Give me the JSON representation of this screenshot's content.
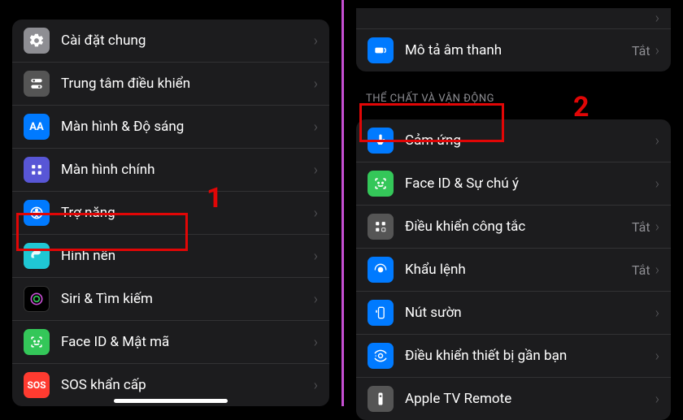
{
  "left": {
    "group1": [
      {
        "label": "Cài đặt chung",
        "key": "general"
      },
      {
        "label": "Trung tâm điều khiển",
        "key": "control-center"
      },
      {
        "label": "Màn hình & Độ sáng",
        "key": "display-brightness"
      },
      {
        "label": "Màn hình chính",
        "key": "home-screen"
      },
      {
        "label": "Trợ năng",
        "key": "accessibility"
      },
      {
        "label": "Hình nền",
        "key": "wallpaper"
      },
      {
        "label": "Siri & Tìm kiếm",
        "key": "siri-search"
      },
      {
        "label": "Face ID & Mật mã",
        "key": "faceid-passcode"
      },
      {
        "label": "SOS khẩn cấp",
        "key": "sos"
      }
    ]
  },
  "right": {
    "top": [
      {
        "label": "Mô tả âm thanh",
        "key": "audio-descriptions",
        "value": "Tắt"
      }
    ],
    "section_header": "THỂ CHẤT VÀ VẬN ĐỘNG",
    "physical": [
      {
        "label": "Cảm ứng",
        "key": "touch"
      },
      {
        "label": "Face ID & Sự chú ý",
        "key": "faceid-attention"
      },
      {
        "label": "Điều khiển công tắc",
        "key": "switch-control",
        "value": "Tắt"
      },
      {
        "label": "Khẩu lệnh",
        "key": "voice-control",
        "value": "Tắt"
      },
      {
        "label": "Nút sườn",
        "key": "side-button"
      },
      {
        "label": "Điều khiển thiết bị gần bạn",
        "key": "nearby-device-control"
      },
      {
        "label": "Apple TV Remote",
        "key": "apple-tv-remote"
      }
    ]
  },
  "off": "Tắt",
  "annotations": {
    "one": "1",
    "two": "2"
  }
}
